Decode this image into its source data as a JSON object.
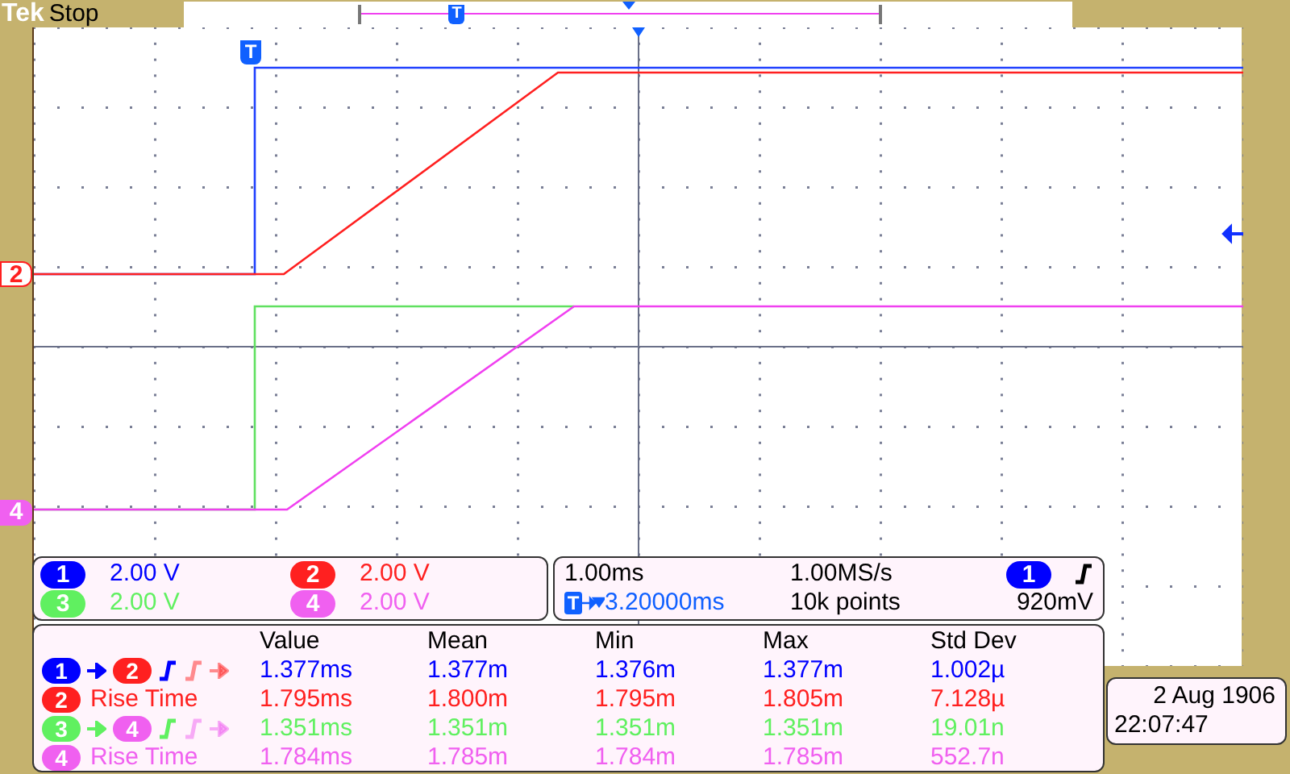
{
  "header": {
    "brand": "Tek",
    "status": "Stop",
    "record_trigger_label": "T"
  },
  "display": {
    "trigger_marker_label": "T"
  },
  "channel_markers": [
    {
      "label": "2",
      "kind": "outline",
      "color": "#ff2020"
    },
    {
      "label": "4",
      "kind": "filled",
      "color": "#f060f0"
    }
  ],
  "channel_scales": [
    {
      "channel": "1",
      "scale": "2.00 V",
      "color": "#0000ff"
    },
    {
      "channel": "2",
      "scale": "2.00 V",
      "color": "#ff2020"
    },
    {
      "channel": "3",
      "scale": "2.00 V",
      "color": "#60f060"
    },
    {
      "channel": "4",
      "scale": "2.00 V",
      "color": "#f060f0"
    }
  ],
  "timebase": {
    "horizontal_scale": "1.00ms",
    "sample_rate": "1.00MS/s",
    "trigger_icon": "T",
    "trigger_position": "3.20000ms",
    "record_length": "10k points",
    "trigger_source": {
      "label": "1",
      "color": "#0000ff"
    },
    "trigger_level": "920mV"
  },
  "measurements": {
    "columns": [
      "Value",
      "Mean",
      "Min",
      "Max",
      "Std Dev"
    ],
    "rows": [
      {
        "kind": "delay",
        "source": {
          "label": "1",
          "color": "#0000ff"
        },
        "target": {
          "label": "2",
          "color": "#ff2020"
        },
        "color": "#0000ff",
        "values": [
          "1.377ms",
          "1.377m",
          "1.376m",
          "1.377m",
          "1.002µ"
        ]
      },
      {
        "kind": "rise",
        "source": {
          "label": "2",
          "color": "#ff2020"
        },
        "label": "Rise Time",
        "color": "#ff2020",
        "values": [
          "1.795ms",
          "1.800m",
          "1.795m",
          "1.805m",
          "7.128µ"
        ]
      },
      {
        "kind": "delay",
        "source": {
          "label": "3",
          "color": "#60f060"
        },
        "target": {
          "label": "4",
          "color": "#f060f0"
        },
        "color": "#60f060",
        "values": [
          "1.351ms",
          "1.351m",
          "1.351m",
          "1.351m",
          "19.01n"
        ]
      },
      {
        "kind": "rise",
        "source": {
          "label": "4",
          "color": "#f060f0"
        },
        "label": "Rise Time",
        "color": "#f060f0",
        "values": [
          "1.784ms",
          "1.785m",
          "1.784m",
          "1.785m",
          "552.7n"
        ]
      }
    ]
  },
  "clock": {
    "date": "2 Aug 1906",
    "time": "22:07:47"
  }
}
